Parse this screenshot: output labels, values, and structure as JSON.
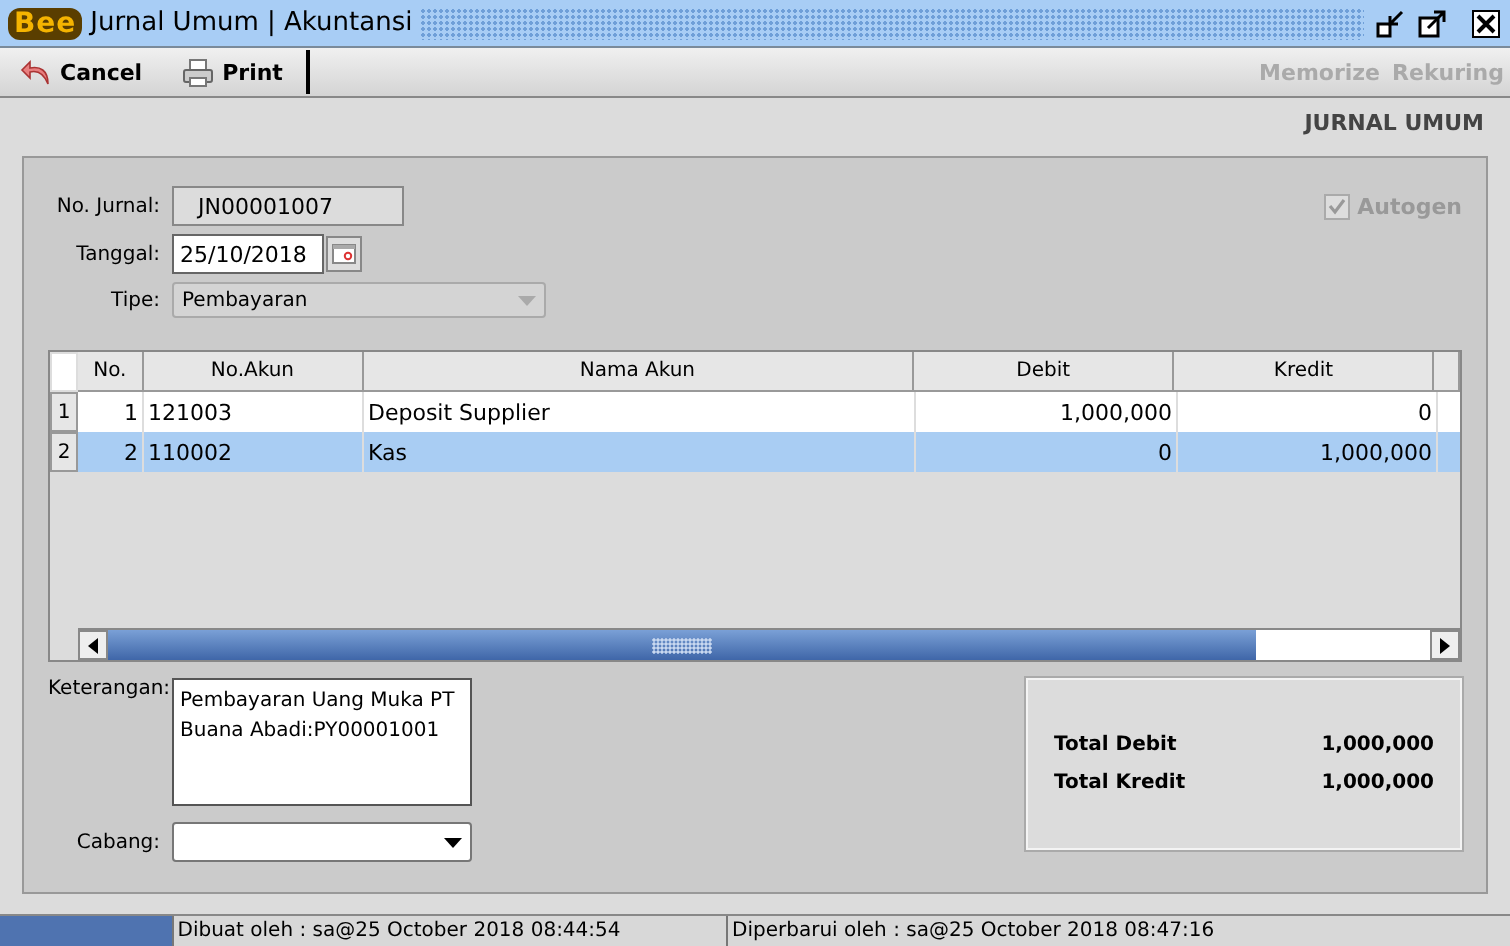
{
  "window": {
    "logo": "Bee",
    "title": "Jurnal Umum | Akuntansi"
  },
  "toolbar": {
    "left": [
      {
        "label": "Cancel",
        "kind": "cancel",
        "disabled": false
      },
      {
        "label": "Print",
        "kind": "print",
        "disabled": false
      }
    ],
    "right": [
      {
        "label": "Memorize",
        "disabled": true
      },
      {
        "label": "Rekuring",
        "disabled": true
      }
    ]
  },
  "form_title": "JURNAL UMUM",
  "fields": {
    "no_jurnal": {
      "label": "No. Jurnal:",
      "value": "JN00001007",
      "disabled": true
    },
    "tanggal": {
      "label": "Tanggal:",
      "value": "25/10/2018"
    },
    "tipe": {
      "label": "Tipe:",
      "value": "Pembayaran",
      "disabled": true
    },
    "autogen": {
      "label": "Autogen",
      "checked": true,
      "disabled": true
    }
  },
  "table": {
    "columns": [
      "No.",
      "No.Akun",
      "Nama Akun",
      "Debit",
      "Kredit"
    ],
    "rows": [
      {
        "row_header": "1",
        "cells": [
          "1",
          "121003",
          "Deposit Supplier",
          "1,000,000",
          "0"
        ],
        "selected": false
      },
      {
        "row_header": "2",
        "cells": [
          "2",
          "110002",
          "Kas",
          "0",
          "1,000,000"
        ],
        "selected": true
      }
    ]
  },
  "keterangan": {
    "label": "Keterangan:",
    "value": "Pembayaran Uang Muka PT\nBuana Abadi:PY00001001"
  },
  "cabang": {
    "label": "Cabang:"
  },
  "totals": [
    {
      "label": "Total Debit",
      "value": "1,000,000"
    },
    {
      "label": "Total Kredit",
      "value": "1,000,000"
    }
  ],
  "status_bar": [
    "Dibuat oleh : sa@25 October 2018  08:44:54",
    "Diperbarui oleh : sa@25 October 2018  08:47:16"
  ]
}
